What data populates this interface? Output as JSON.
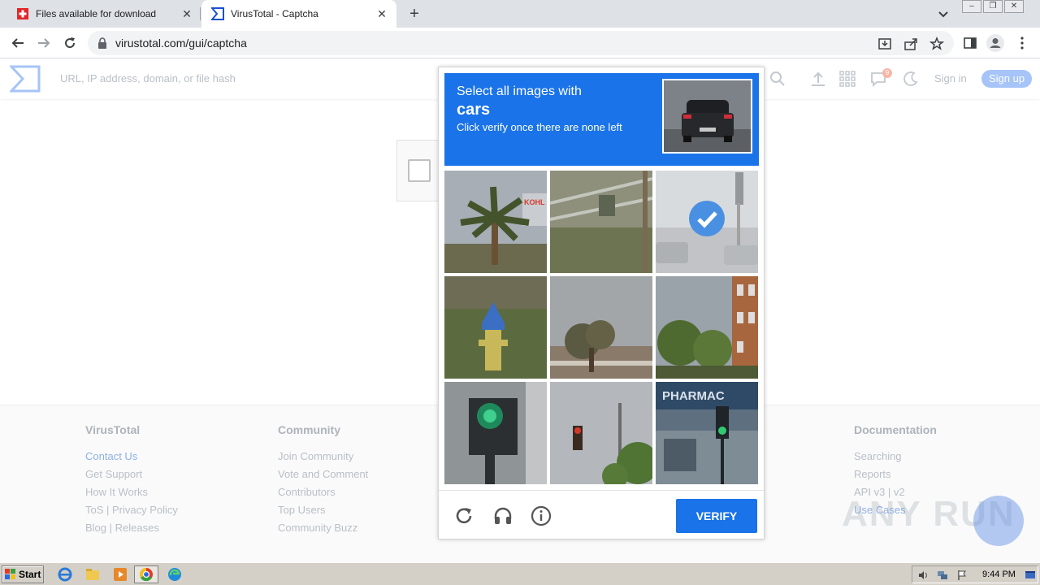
{
  "browser": {
    "tabs": [
      {
        "title": "Files available for download",
        "active": false
      },
      {
        "title": "VirusTotal - Captcha",
        "active": true
      }
    ],
    "url": "virustotal.com/gui/captcha"
  },
  "vt_header": {
    "search_placeholder": "URL, IP address, domain, or file hash",
    "notification_count": "9",
    "signin": "Sign in",
    "signup": "Sign up"
  },
  "captcha": {
    "prompt_line1": "Select all images with",
    "target": "cars",
    "prompt_line3": "Click verify once there are none left",
    "verify_label": "VERIFY",
    "tiles": [
      {
        "content": "palm tree with sign",
        "selected": false
      },
      {
        "content": "railing and grass",
        "selected": false
      },
      {
        "content": "street with traffic light",
        "selected": true
      },
      {
        "content": "fire hydrant",
        "selected": false
      },
      {
        "content": "tree and building",
        "selected": false
      },
      {
        "content": "brick building and trees",
        "selected": false
      },
      {
        "content": "traffic light close-up",
        "selected": false
      },
      {
        "content": "traffic light and trees",
        "selected": false
      },
      {
        "content": "pharmacy with traffic light",
        "selected": false
      }
    ],
    "pharmacy_text": "PHARMAC"
  },
  "footer": {
    "columns": [
      {
        "title": "VirusTotal",
        "links": [
          "Contact Us",
          "Get Support",
          "How It Works",
          "ToS | Privacy Policy",
          "Blog | Releases"
        ]
      },
      {
        "title": "Community",
        "links": [
          "Join Community",
          "Vote and Comment",
          "Contributors",
          "Top Users",
          "Community Buzz"
        ]
      },
      {
        "title": "Documentation",
        "links": [
          "Searching",
          "Reports",
          "API v3 | v2",
          "Use Cases"
        ]
      }
    ]
  },
  "watermark": "ANY RUN",
  "taskbar": {
    "start_label": "Start",
    "time": "9:44 PM"
  },
  "colors": {
    "accent": "#1a73e8",
    "signup_bg": "#a6c4f7",
    "tab_strip": "#dee1e6",
    "taskbar": "#d4d0c8"
  }
}
